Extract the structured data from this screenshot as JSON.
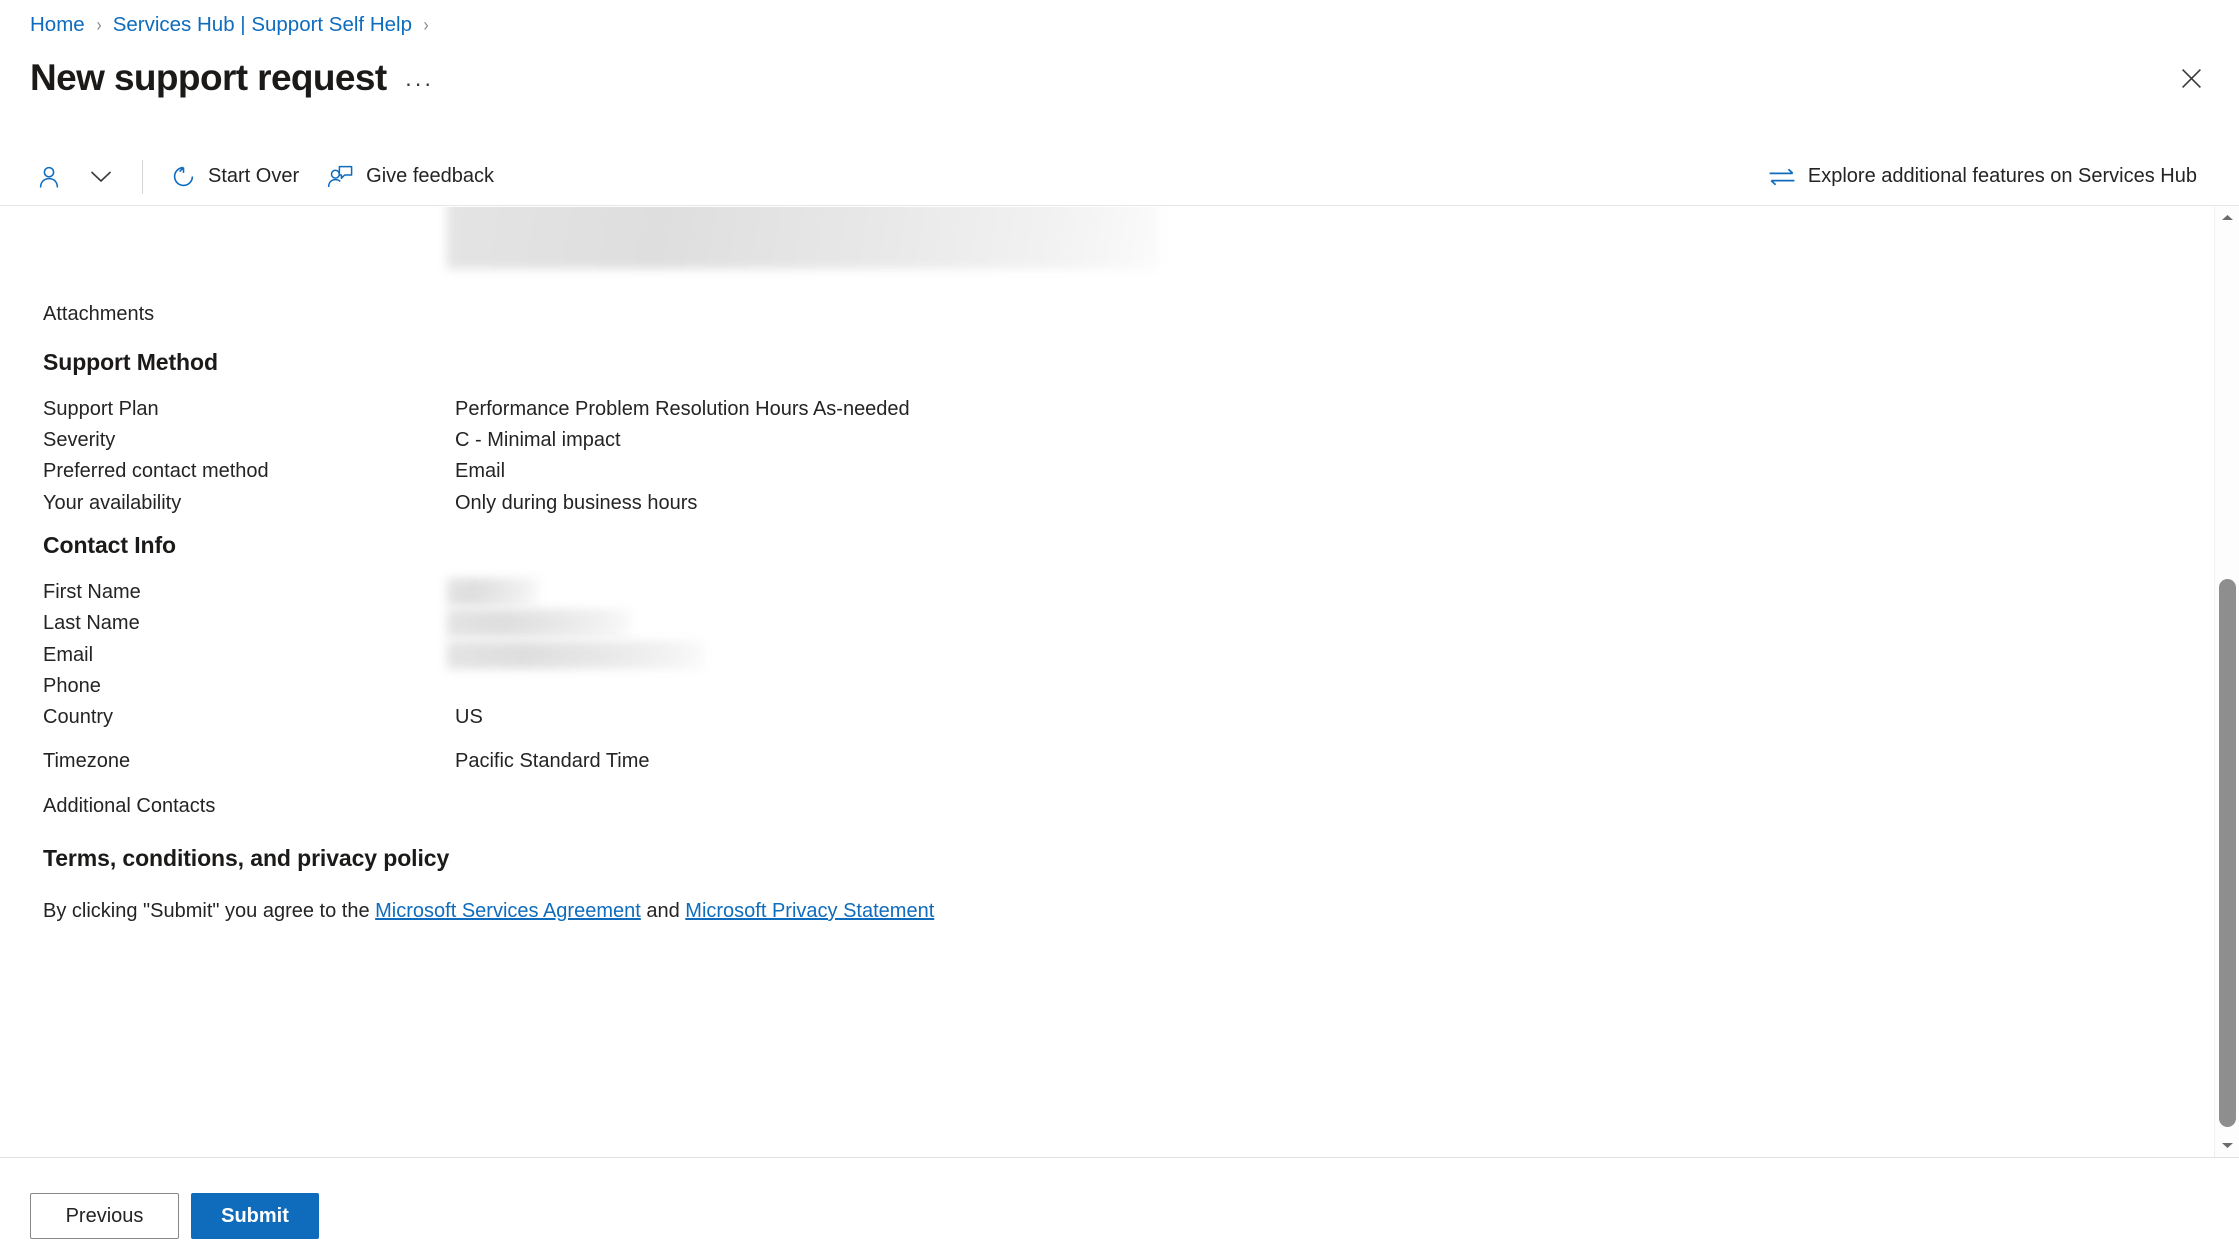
{
  "breadcrumb": {
    "items": [
      {
        "label": "Home"
      },
      {
        "label": "Services Hub | Support Self Help"
      }
    ],
    "separator": "›"
  },
  "header": {
    "title": "New support request",
    "overflow_label": "···",
    "close_icon": "close-icon"
  },
  "commandbar": {
    "persona_icon": "person-icon",
    "chevron_icon": "chevron-down-icon",
    "start_over": {
      "label": "Start Over",
      "icon": "refresh-icon"
    },
    "give_feedback": {
      "label": "Give feedback",
      "icon": "person-feedback-icon"
    },
    "explore": {
      "label": "Explore additional features on Services Hub",
      "icon": "swap-arrows-icon"
    }
  },
  "form": {
    "attachments_label": "Attachments",
    "sections": [
      {
        "heading": "Support Method",
        "rows": [
          {
            "label": "Support Plan",
            "value": "Performance Problem Resolution Hours As-needed"
          },
          {
            "label": "Severity",
            "value": "C - Minimal impact"
          },
          {
            "label": "Preferred contact method",
            "value": "Email"
          },
          {
            "label": "Your availability",
            "value": "Only during business hours"
          }
        ]
      },
      {
        "heading": "Contact Info",
        "rows": [
          {
            "label": "First Name",
            "value": "",
            "redacted": true,
            "redact_width": 92
          },
          {
            "label": "Last Name",
            "value": "",
            "redacted": true,
            "redact_width": 185
          },
          {
            "label": "Email",
            "value": "",
            "redacted": true,
            "redact_width": 258
          },
          {
            "label": "Phone",
            "value": ""
          },
          {
            "label": "Country",
            "value": "US"
          },
          {
            "label": "Timezone",
            "value": "Pacific Standard Time"
          },
          {
            "label": "Additional Contacts",
            "value": ""
          }
        ]
      }
    ]
  },
  "terms": {
    "heading": "Terms, conditions, and privacy policy",
    "prefix": "By clicking \"Submit\" you agree to the ",
    "link1": "Microsoft Services Agreement",
    "middle": " and ",
    "link2": "Microsoft Privacy Statement"
  },
  "footer": {
    "previous_label": "Previous",
    "submit_label": "Submit"
  },
  "colors": {
    "accent": "#0f6cbd",
    "link": "#0f6cbd",
    "text": "#242424",
    "heading": "#1b1a19",
    "border": "#e1e1e1",
    "scrollbar_thumb": "#8e8e8e"
  }
}
